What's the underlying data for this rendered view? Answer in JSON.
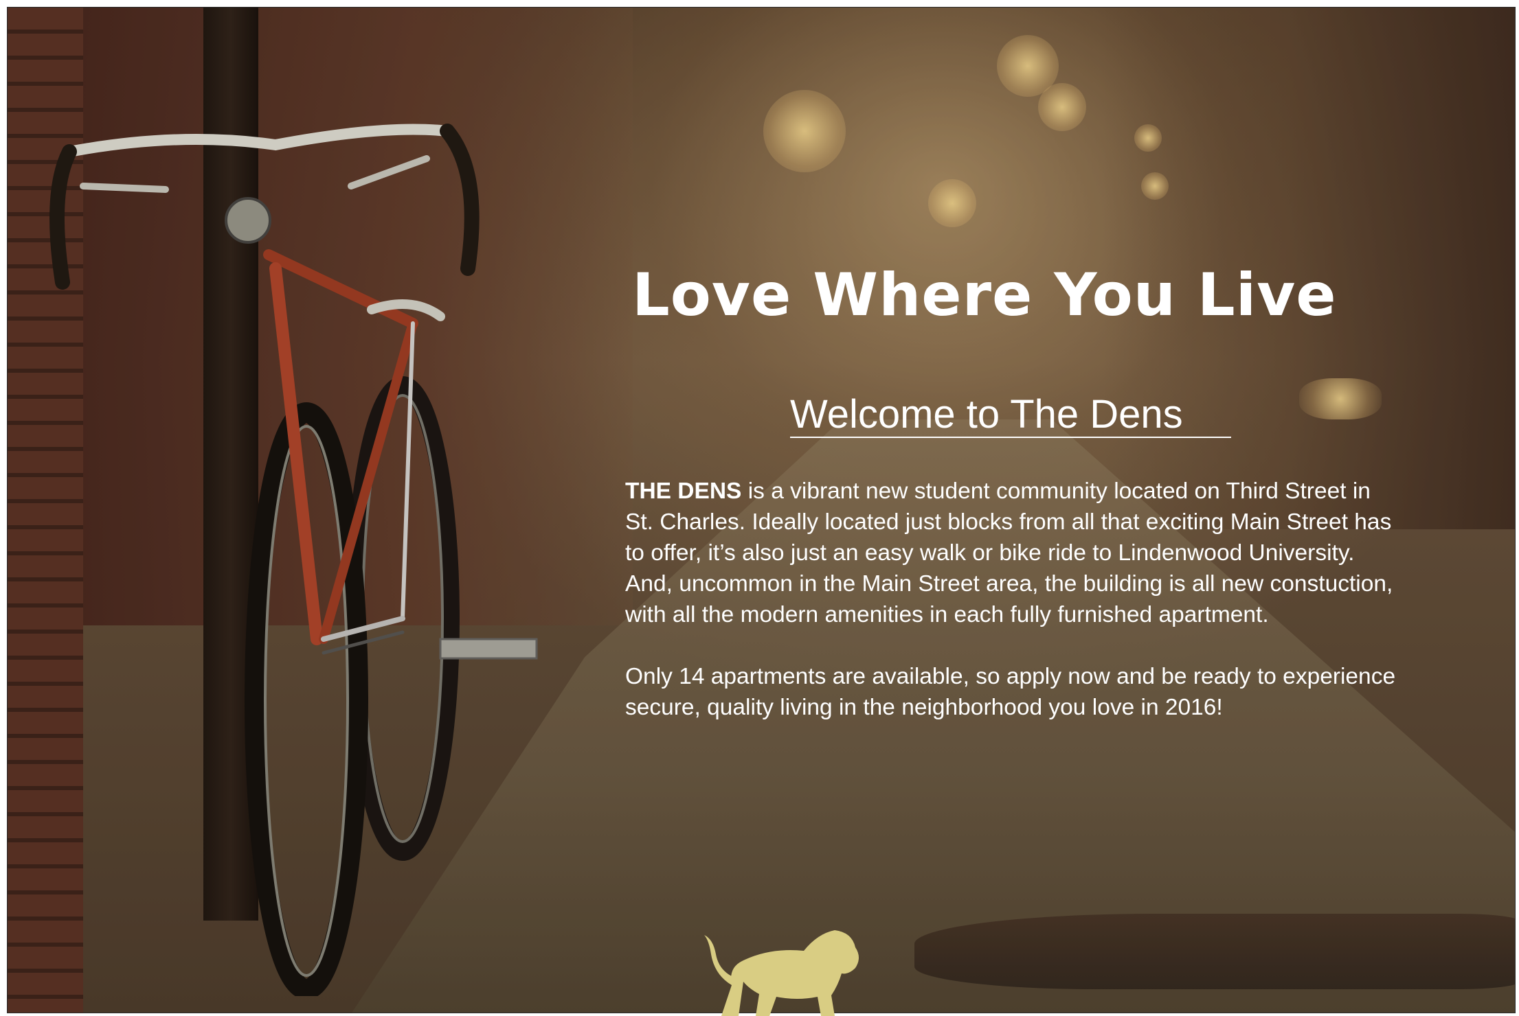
{
  "hero": {
    "headline": "Love Where You Live",
    "subheading": "Welcome to The Dens"
  },
  "intro": {
    "brand_name": "THE DENS",
    "paragraph1_rest": " is a vibrant new student community located on Third Street in St. Charles.  Ideally located just blocks from all that exciting  Main Street has to offer, it’s also just an easy walk or bike ride to Lindenwood University.  And, uncommon in the Main Street area,  the building is all new constuction, with all the modern amenities in each fully furnished apartment.",
    "paragraph2": "Only 14 apartments are available, so apply now and be ready to experience secure, quality living in the  neighborhood you love in 2016!"
  },
  "images": {
    "background": "alley-bicycle-photo",
    "logo": "lion-logo-icon"
  },
  "colors": {
    "text": "#ffffff",
    "logo": "#d9cd83"
  }
}
